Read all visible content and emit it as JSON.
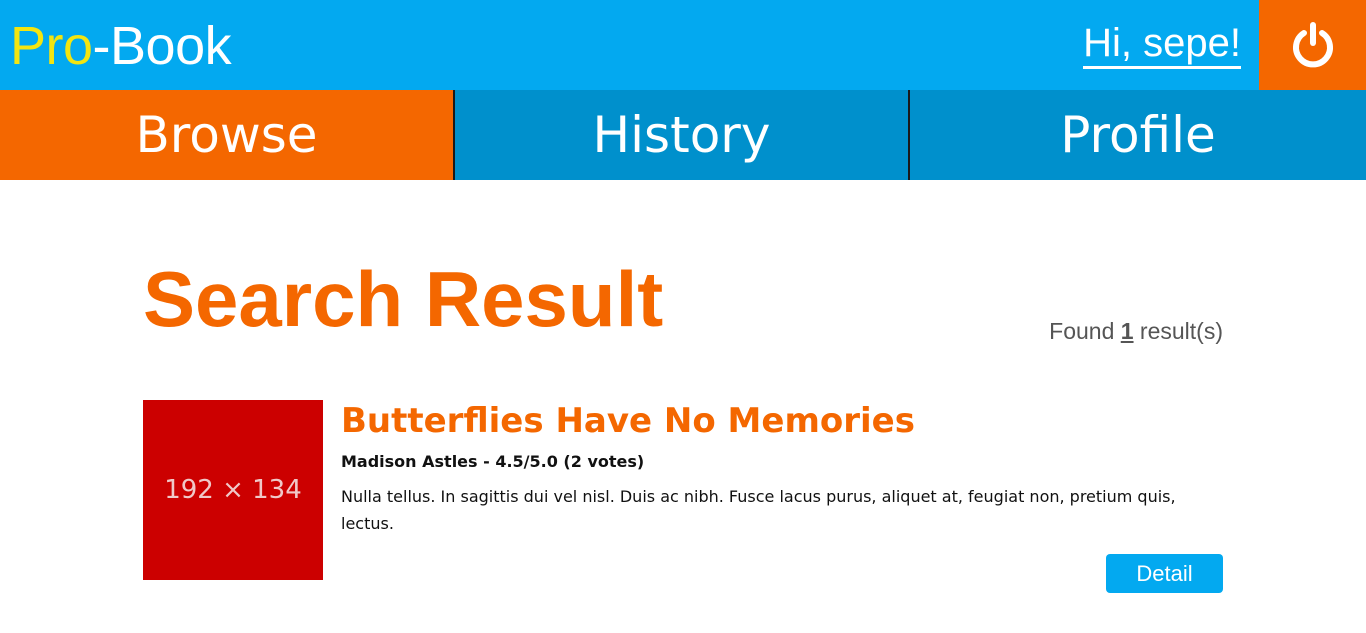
{
  "header": {
    "logo_part1": "Pro",
    "logo_part2": "-Book",
    "greeting": "Hi, sepe!",
    "logout_icon": "power-icon",
    "colors": {
      "bar": "#03a9f0",
      "logo_accent": "#f3e510",
      "logout_bg": "#f46700"
    }
  },
  "nav": {
    "tabs": [
      {
        "label": "Browse",
        "active": true
      },
      {
        "label": "History",
        "active": false
      },
      {
        "label": "Profile",
        "active": false
      }
    ],
    "colors": {
      "active": "#f46700",
      "inactive": "#0090cc"
    }
  },
  "main": {
    "title": "Search Result",
    "found_prefix": "Found ",
    "found_count": "1",
    "found_suffix": " result(s)",
    "results": [
      {
        "thumbnail_text": "192 × 134",
        "title": "Butterflies Have No Memories",
        "meta": "Madison Astles - 4.5/5.0 (2 votes)",
        "description": "Nulla tellus. In sagittis dui vel nisl. Duis ac nibh. Fusce lacus purus, aliquet at, feugiat non, pretium quis, lectus.",
        "detail_label": "Detail"
      }
    ],
    "colors": {
      "accent": "#f46700",
      "thumb_bg": "#cc0000",
      "button": "#03a9f0"
    }
  }
}
